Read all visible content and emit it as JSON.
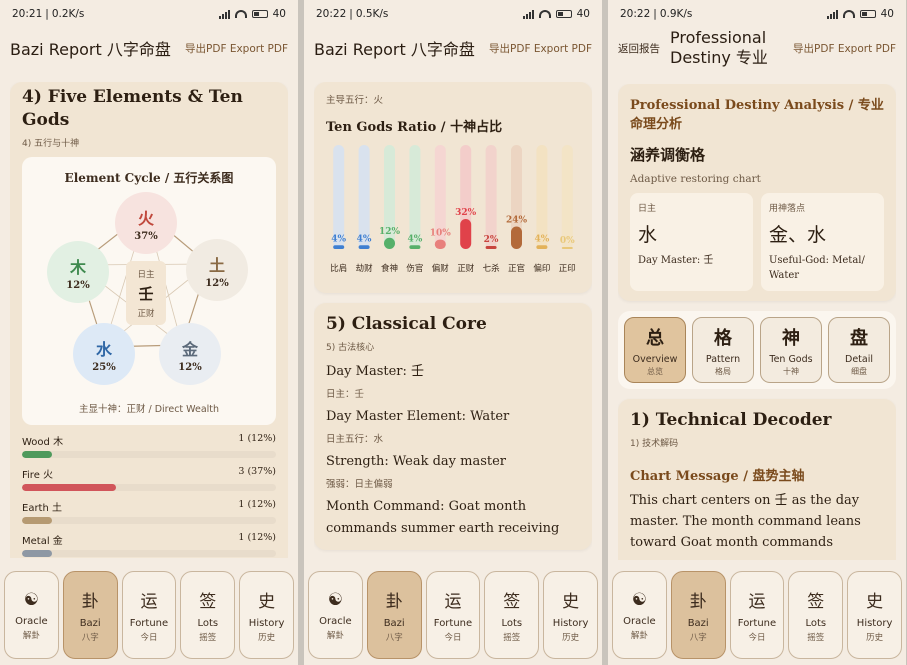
{
  "screens": [
    {
      "time": "20:21",
      "speed": "0.2K/s",
      "battery": "40"
    },
    {
      "time": "20:22",
      "speed": "0.5K/s",
      "battery": "40"
    },
    {
      "time": "20:22",
      "speed": "0.9K/s",
      "battery": "40"
    }
  ],
  "app": {
    "title": "Bazi Report 八字命盘",
    "export_label": "导出PDF Export PDF"
  },
  "five_elements": {
    "title": "4) Five Elements & Ten Gods",
    "subtitle": "4) 五行与十神",
    "cycle_title": "Element Cycle / 五行关系图",
    "nodes": [
      {
        "char": "火",
        "pct": "37%",
        "color": "#c0483c",
        "bg": "#f7e3df"
      },
      {
        "char": "土",
        "pct": "12%",
        "color": "#8a6a44",
        "bg": "#f1ebe2"
      },
      {
        "char": "金",
        "pct": "12%",
        "color": "#5c6a7a",
        "bg": "#e9edf2"
      },
      {
        "char": "水",
        "pct": "25%",
        "color": "#2f67a6",
        "bg": "#dde9f6"
      },
      {
        "char": "木",
        "pct": "12%",
        "color": "#3f8a4f",
        "bg": "#e2f0e3"
      }
    ],
    "center": {
      "label": "日主",
      "char": "壬",
      "god": "正财"
    },
    "foot": "主显十神：正财 / Direct Wealth",
    "bars": [
      {
        "label": "Wood 木",
        "value": "1 (12%)",
        "fraction": 0.12,
        "color": "#4f9a5c"
      },
      {
        "label": "Fire 火",
        "value": "3 (37%)",
        "fraction": 0.37,
        "color": "#d1555a"
      },
      {
        "label": "Earth 土",
        "value": "1 (12%)",
        "fraction": 0.12,
        "color": "#b69a72"
      },
      {
        "label": "Metal 金",
        "value": "1 (12%)",
        "fraction": 0.12,
        "color": "#8e98a4"
      }
    ]
  },
  "ten_gods": {
    "dominant": "主导五行：火",
    "title": "Ten Gods Ratio / 十神占比",
    "chart_data": {
      "type": "bar",
      "categories": [
        "比肩",
        "劫财",
        "食神",
        "伤官",
        "偏财",
        "正财",
        "七杀",
        "正官",
        "偏印",
        "正印"
      ],
      "values": [
        4,
        4,
        12,
        4,
        10,
        32,
        2,
        24,
        4,
        0
      ],
      "value_labels": [
        "4%",
        "4%",
        "12%",
        "4%",
        "10%",
        "32%",
        "2%",
        "24%",
        "4%",
        "0%"
      ],
      "colors": [
        "#3f7fd1",
        "#3f7fd1",
        "#56b06a",
        "#56b06a",
        "#e8807c",
        "#e0424a",
        "#c8453e",
        "#b36a3a",
        "#e3b25a",
        "#e9c87a"
      ],
      "track_colors": [
        "#d9e2ee",
        "#d9e2ee",
        "#d7ead8",
        "#d7ead8",
        "#f5d6d2",
        "#f3cdca",
        "#f2d3cc",
        "#ecd5c2",
        "#f3e2c2",
        "#f3e4c6"
      ],
      "ylim": [
        0,
        100
      ]
    }
  },
  "classical": {
    "title": "5) Classical Core",
    "subtitle": "5) 古法核心",
    "lines": [
      {
        "main": "Day Master: 壬",
        "small": "日主：壬"
      },
      {
        "main": "Day Master Element: Water",
        "small": "日主五行：水"
      },
      {
        "main": "Strength: Weak day master",
        "small": "强弱：日主偏弱"
      },
      {
        "main": "Month Command: Goat month commands summer earth receiving",
        "small": ""
      }
    ]
  },
  "nav": [
    {
      "glyph": "☯",
      "en": "Oracle",
      "zh": "解卦"
    },
    {
      "glyph": "卦",
      "en": "Bazi",
      "zh": "八字"
    },
    {
      "glyph": "运",
      "en": "Fortune",
      "zh": "今日"
    },
    {
      "glyph": "签",
      "en": "Lots",
      "zh": "摇签"
    },
    {
      "glyph": "史",
      "en": "History",
      "zh": "历史"
    }
  ],
  "pro": {
    "back": "返回报告",
    "title": "Professional Destiny 专业命理",
    "head": "Professional Destiny Analysis / 专业命理分析",
    "pattern": "涵养调衡格",
    "pattern_sub": "Adaptive restoring chart",
    "dm_label": "日主",
    "dm_value": "水",
    "dm_sub": "Day Master: 壬",
    "ug_label": "用神落点",
    "ug_value": "金、水",
    "ug_sub": "Useful-God: Metal/ Water",
    "segments": [
      {
        "glyph": "总",
        "en": "Overview",
        "zh": "总览"
      },
      {
        "glyph": "格",
        "en": "Pattern",
        "zh": "格局"
      },
      {
        "glyph": "神",
        "en": "Ten Gods",
        "zh": "十神"
      },
      {
        "glyph": "盘",
        "en": "Detail",
        "zh": "细盘"
      }
    ],
    "tech_title": "1) Technical Decoder",
    "tech_sub": "1) 技术解码",
    "msg_title": "Chart Message / 盘势主轴",
    "msg_body": "This chart centers on 壬 as the day master. The month command leans toward Goat month commands"
  }
}
